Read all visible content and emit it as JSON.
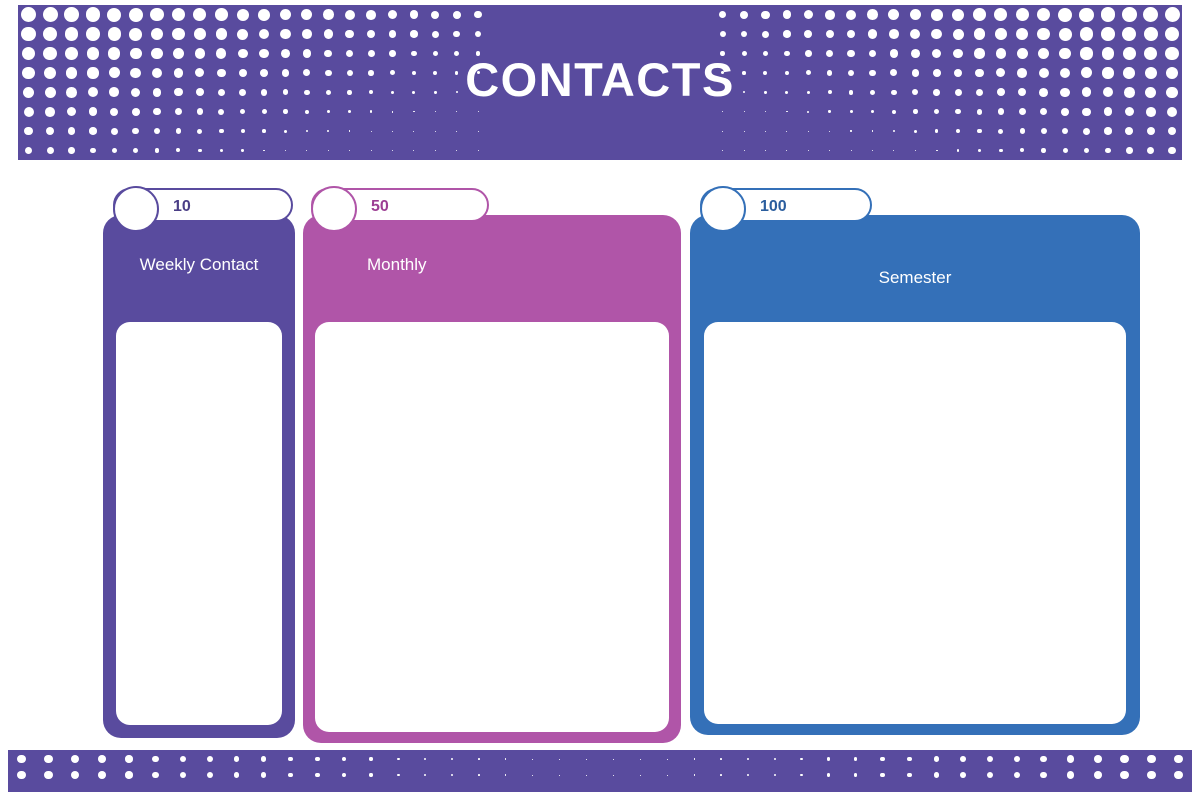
{
  "header": {
    "title": "CONTACTS",
    "background_color": "#594B9E",
    "title_color": "#FFFFFF",
    "pattern": "halftone-dot-grid"
  },
  "cards": [
    {
      "badge_number": "10",
      "label": "Weekly Contact",
      "color": "#594B9E",
      "number_color": "#4A3E86",
      "inner_panel_color": "#FFFFFF",
      "body_text": ""
    },
    {
      "badge_number": "50",
      "label": "Monthly",
      "color": "#B055A8",
      "number_color": "#9C3E93",
      "inner_panel_color": "#FFFFFF",
      "body_text": ""
    },
    {
      "badge_number": "100",
      "label": "Semester",
      "color": "#3470B8",
      "number_color": "#2B5E9E",
      "inner_panel_color": "#FFFFFF",
      "body_text": ""
    }
  ],
  "footer": {
    "background_color": "#594B9E",
    "pattern": "halftone-dot-grid"
  }
}
